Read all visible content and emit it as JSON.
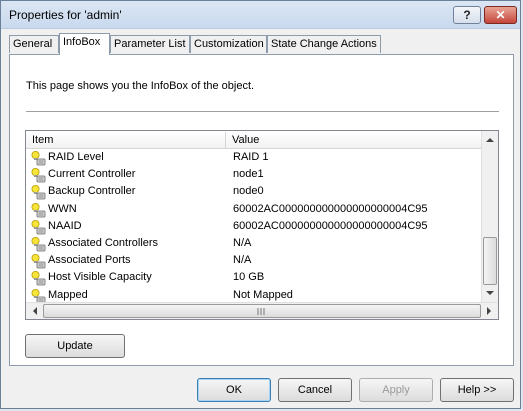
{
  "window": {
    "title": "Properties for 'admin'",
    "help_glyph": "?",
    "close_glyph": "✕"
  },
  "tabs": [
    "General",
    "InfoBox",
    "Parameter List",
    "Customization",
    "State Change Actions"
  ],
  "active_tab": "InfoBox",
  "description": "This page shows you the InfoBox of the object.",
  "list": {
    "columns": [
      "Item",
      "Value"
    ],
    "rows": [
      {
        "item": "RAID Level",
        "value": "RAID 1",
        "icon": "lightbulb-device-icon"
      },
      {
        "item": "Current Controller",
        "value": "node1",
        "icon": "lightbulb-device-icon"
      },
      {
        "item": "Backup Controller",
        "value": "node0",
        "icon": "lightbulb-device-icon"
      },
      {
        "item": "WWN",
        "value": "60002AC000000000000000000004C95",
        "icon": "lightbulb-device-icon"
      },
      {
        "item": "NAAID",
        "value": "60002AC000000000000000000004C95",
        "icon": "lightbulb-device-icon"
      },
      {
        "item": "Associated Controllers",
        "value": "N/A",
        "icon": "lightbulb-device-icon"
      },
      {
        "item": "Associated Ports",
        "value": "N/A",
        "icon": "lightbulb-device-icon"
      },
      {
        "item": "Host Visible Capacity",
        "value": "10 GB",
        "icon": "lightbulb-device-icon"
      },
      {
        "item": "Mapped",
        "value": "Not Mapped",
        "icon": "lightbulb-device-icon"
      }
    ],
    "vertical_scroll_position": 0.82
  },
  "buttons": {
    "update": "Update",
    "ok": "OK",
    "cancel": "Cancel",
    "apply": "Apply",
    "help": "Help >>"
  }
}
